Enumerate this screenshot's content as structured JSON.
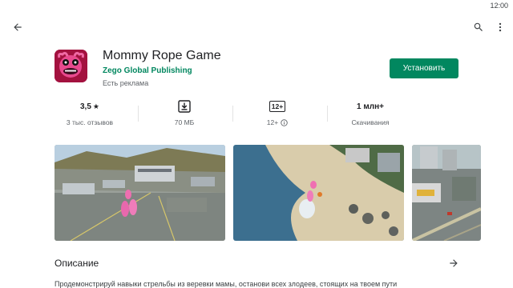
{
  "status_bar": {
    "time": "12:00"
  },
  "topbar": {
    "back_icon": "arrow-back-icon",
    "search_icon": "search-icon",
    "more_icon": "more-vert-icon"
  },
  "app": {
    "title": "Mommy Rope Game",
    "developer": "Zego Global Publishing",
    "ads_note": "Есть реклама",
    "install_label": "Установить",
    "accent_color": "#01875f"
  },
  "stats": {
    "rating": {
      "value": "3,5",
      "star": "★",
      "label": "3 тыс. отзывов"
    },
    "size": {
      "icon": "download-box-icon",
      "label": "70 МБ"
    },
    "age": {
      "badge": "12+",
      "label": "12+",
      "info_icon": "info-icon"
    },
    "downloads": {
      "value": "1 млн+",
      "label": "Скачивания"
    }
  },
  "screenshots": [
    {
      "name": "screenshot-airport"
    },
    {
      "name": "screenshot-beach"
    },
    {
      "name": "screenshot-city"
    }
  ],
  "description": {
    "title": "Описание",
    "arrow_icon": "arrow-forward-icon",
    "text": "Продемонстрируй навыки стрельбы из веревки мамы, останови всех злодеев, стоящих на твоем пути"
  }
}
